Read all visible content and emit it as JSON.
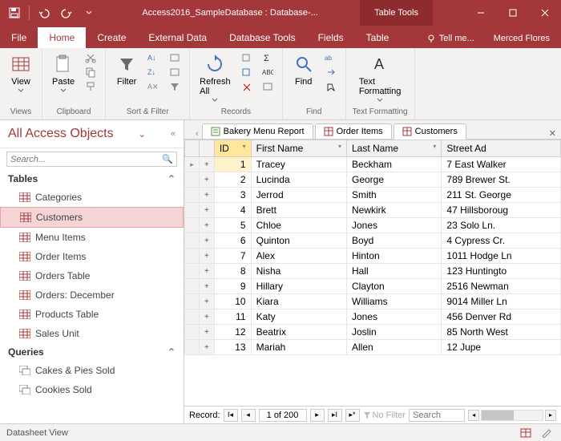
{
  "title": "Access2016_SampleDatabase : Database-...",
  "tableTools": "Table Tools",
  "user": "Merced Flores",
  "tellMe": "Tell me...",
  "menuTabs": {
    "file": "File",
    "home": "Home",
    "create": "Create",
    "externalData": "External Data",
    "databaseTools": "Database Tools",
    "fields": "Fields",
    "table": "Table"
  },
  "ribbon": {
    "views": {
      "view": "View",
      "label": "Views"
    },
    "clipboard": {
      "paste": "Paste",
      "label": "Clipboard"
    },
    "sortFilter": {
      "filter": "Filter",
      "label": "Sort & Filter"
    },
    "records": {
      "refreshAll": "Refresh\nAll",
      "label": "Records"
    },
    "find": {
      "find": "Find",
      "label": "Find"
    },
    "textFormat": {
      "textFormatting": "Text\nFormatting",
      "label": "Text Formatting"
    }
  },
  "navPane": {
    "header": "All Access Objects",
    "searchPlaceholder": "Search...",
    "tablesLabel": "Tables",
    "queriesLabel": "Queries",
    "tables": [
      "Categories",
      "Customers",
      "Menu Items",
      "Order Items",
      "Orders Table",
      "Orders: December",
      "Products Table",
      "Sales Unit"
    ],
    "queries": [
      "Cakes & Pies Sold",
      "Cookies Sold"
    ],
    "selected": "Customers"
  },
  "docTabs": {
    "t0": "Bakery Menu Report",
    "t1": "Order Items",
    "t2": "Customers"
  },
  "columns": {
    "id": "ID",
    "firstName": "First Name",
    "lastName": "Last Name",
    "street": "Street Ad"
  },
  "rows": [
    {
      "id": 1,
      "first": "Tracey",
      "last": "Beckham",
      "street": "7 East Walker"
    },
    {
      "id": 2,
      "first": "Lucinda",
      "last": "George",
      "street": "789 Brewer St."
    },
    {
      "id": 3,
      "first": "Jerrod",
      "last": "Smith",
      "street": "211 St. George"
    },
    {
      "id": 4,
      "first": "Brett",
      "last": "Newkirk",
      "street": "47 Hillsboroug"
    },
    {
      "id": 5,
      "first": "Chloe",
      "last": "Jones",
      "street": "23 Solo Ln."
    },
    {
      "id": 6,
      "first": "Quinton",
      "last": "Boyd",
      "street": "4 Cypress Cr."
    },
    {
      "id": 7,
      "first": "Alex",
      "last": "Hinton",
      "street": "1011 Hodge Ln"
    },
    {
      "id": 8,
      "first": "Nisha",
      "last": "Hall",
      "street": "123 Huntingto"
    },
    {
      "id": 9,
      "first": "Hillary",
      "last": "Clayton",
      "street": "2516 Newman"
    },
    {
      "id": 10,
      "first": "Kiara",
      "last": "Williams",
      "street": "9014 Miller Ln"
    },
    {
      "id": 11,
      "first": "Katy",
      "last": "Jones",
      "street": "456 Denver Rd"
    },
    {
      "id": 12,
      "first": "Beatrix",
      "last": "Joslin",
      "street": "85 North West"
    },
    {
      "id": 13,
      "first": "Mariah",
      "last": "Allen",
      "street": "12 Jupe"
    }
  ],
  "recordBar": {
    "label": "Record:",
    "position": "1 of 200",
    "noFilter": "No Filter",
    "searchPlaceholder": "Search"
  },
  "statusBar": {
    "view": "Datasheet View"
  }
}
